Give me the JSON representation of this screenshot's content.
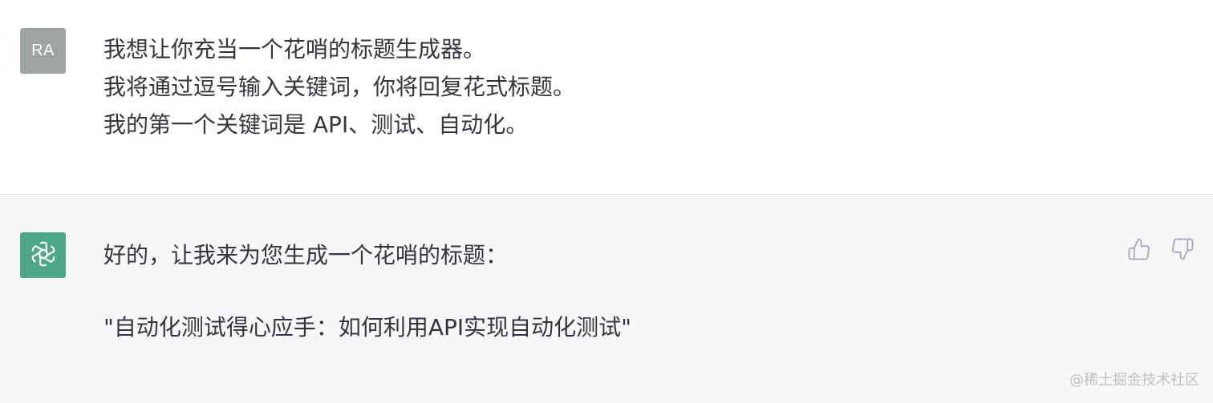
{
  "user": {
    "avatar_initials": "RA",
    "avatar_color": "#9ea5a4",
    "lines": [
      "我想让你充当一个花哨的标题生成器。",
      "我将通过逗号输入关键词，你将回复花式标题。",
      "我的第一个关键词是 API、测试、自动化。"
    ]
  },
  "assistant": {
    "avatar_icon": "openai-logo-icon",
    "avatar_color": "#4ea888",
    "lines": [
      "好的，让我来为您生成一个花哨的标题：",
      "\"自动化测试得心应手：如何利用API实现自动化测试\""
    ],
    "feedback": {
      "thumbs_up_icon": "thumbs-up-icon",
      "thumbs_down_icon": "thumbs-down-icon"
    }
  },
  "watermark": "@稀土掘金技术社区"
}
